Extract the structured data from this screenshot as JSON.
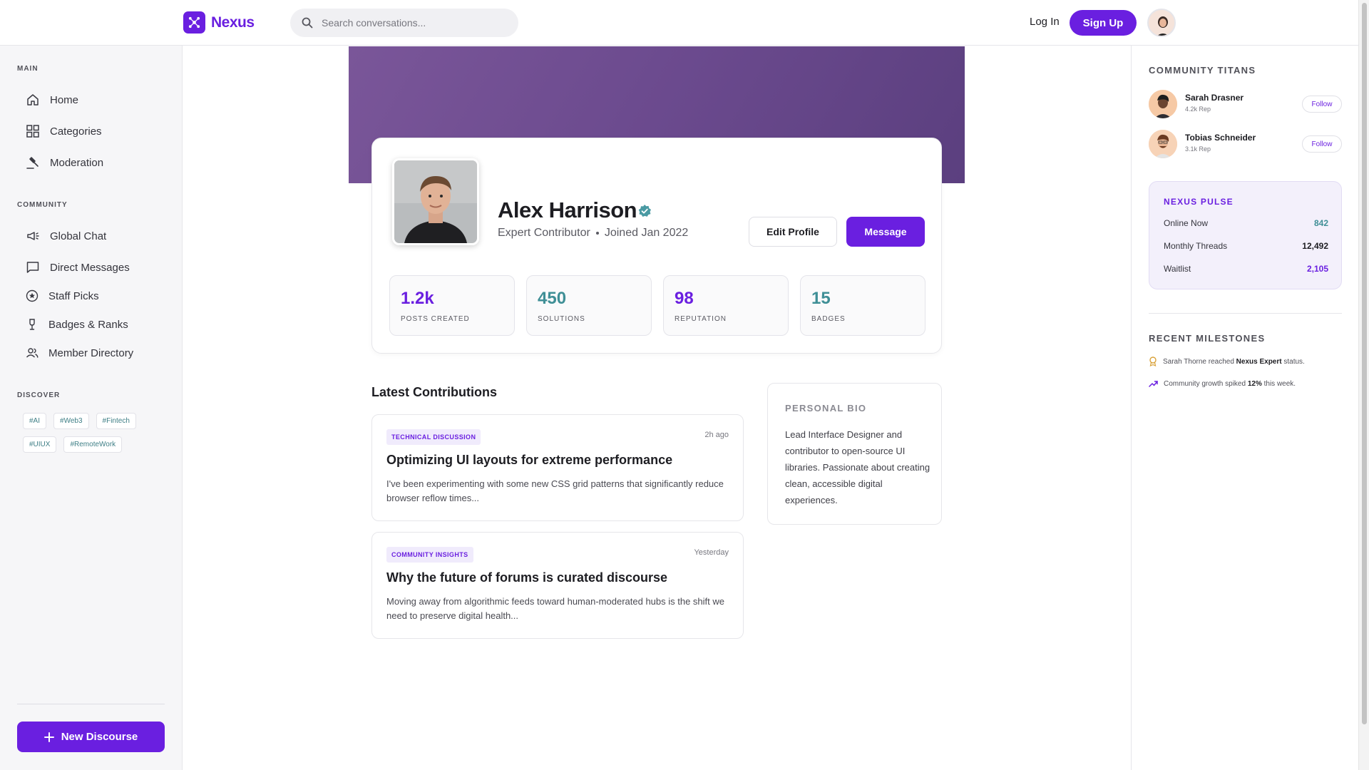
{
  "brand": {
    "name": "Nexus",
    "accent": "#6a1fe0",
    "teal": "#3f8f96"
  },
  "header": {
    "search_placeholder": "Search conversations...",
    "login_label": "Log In",
    "signup_label": "Sign Up"
  },
  "sidebar": {
    "main_title": "MAIN",
    "main_items": [
      {
        "label": "Home",
        "icon": "home-icon"
      },
      {
        "label": "Categories",
        "icon": "grid-icon"
      },
      {
        "label": "Moderation",
        "icon": "gavel-icon"
      }
    ],
    "community_title": "COMMUNITY",
    "community_items": [
      {
        "label": "Global Chat",
        "icon": "megaphone-icon"
      },
      {
        "label": "Direct Messages",
        "icon": "chat-bubble-icon"
      },
      {
        "label": "Staff Picks",
        "icon": "star-circle-icon"
      },
      {
        "label": "Badges & Ranks",
        "icon": "trophy-icon"
      },
      {
        "label": "Member Directory",
        "icon": "users-icon"
      }
    ],
    "discover_title": "DISCOVER",
    "tags": [
      "#AI",
      "#Web3",
      "#Fintech",
      "#UIUX",
      "#RemoteWork"
    ],
    "new_button_label": "New Discourse"
  },
  "profile": {
    "name": "Alex Harrison",
    "role": "Expert Contributor",
    "joined": "Joined Jan 2022",
    "edit_label": "Edit Profile",
    "message_label": "Message",
    "stats": [
      {
        "value": "1.2k",
        "label": "POSTS CREATED",
        "color": "#6a1fe0"
      },
      {
        "value": "450",
        "label": "SOLUTIONS",
        "color": "#3f8f96"
      },
      {
        "value": "98",
        "label": "REPUTATION",
        "color": "#6a1fe0"
      },
      {
        "value": "15",
        "label": "BADGES",
        "color": "#3f8f96"
      }
    ]
  },
  "contributions": {
    "title": "Latest Contributions",
    "posts": [
      {
        "tag": "TECHNICAL DISCUSSION",
        "time": "2h ago",
        "title": "Optimizing UI layouts for extreme performance",
        "excerpt": "I've been experimenting with some new CSS grid patterns that significantly reduce browser reflow times..."
      },
      {
        "tag": "COMMUNITY INSIGHTS",
        "time": "Yesterday",
        "title": "Why the future of forums is curated discourse",
        "excerpt": "Moving away from algorithmic feeds toward human-moderated hubs is the shift we need to preserve digital health..."
      }
    ]
  },
  "bio": {
    "title": "PERSONAL BIO",
    "text": "Lead Interface Designer and contributor to open-source UI libraries. Passionate about creating clean, accessible digital experiences."
  },
  "right": {
    "titans_title": "COMMUNITY TITANS",
    "titans": [
      {
        "name": "Sarah Drasner",
        "rep": "4.2k Rep",
        "follow": "Follow"
      },
      {
        "name": "Tobias Schneider",
        "rep": "3.1k Rep",
        "follow": "Follow"
      }
    ],
    "pulse_title": "NEXUS PULSE",
    "pulse": [
      {
        "label": "Online Now",
        "value": "842",
        "color": "#3f8f96"
      },
      {
        "label": "Monthly Threads",
        "value": "12,492",
        "color": "#1d1d22"
      },
      {
        "label": "Waitlist",
        "value": "2,105",
        "color": "#6a1fe0"
      }
    ],
    "milestones_title": "RECENT MILESTONES",
    "milestones": [
      {
        "pre": "Sarah Thorne reached ",
        "bold": "Nexus Expert",
        "post": " status.",
        "icon": "award-icon"
      },
      {
        "pre": "Community growth spiked ",
        "bold": "12%",
        "post": " this week.",
        "icon": "trend-up-icon"
      }
    ]
  }
}
